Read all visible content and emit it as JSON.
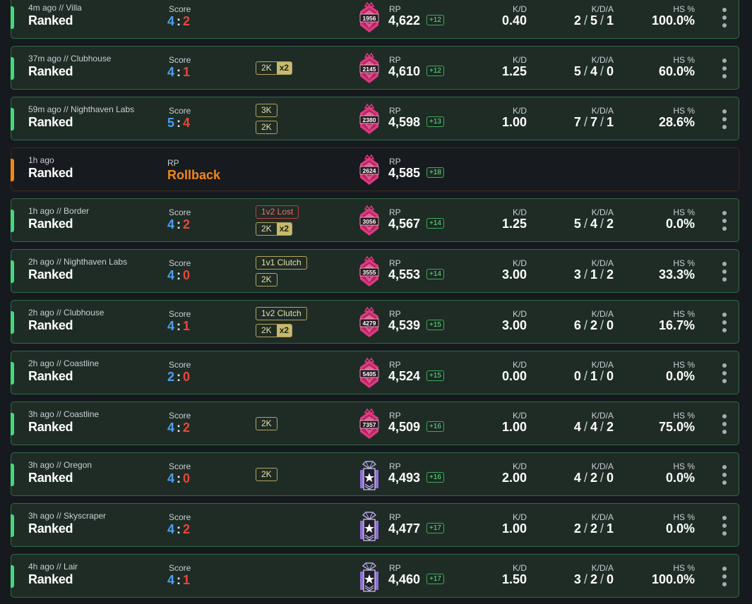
{
  "matches": [
    {
      "meta": "4m ago // Villa",
      "mode": "Ranked",
      "score_label": "Score",
      "score_us": "4",
      "score_sep": ":",
      "score_them": "2",
      "tags": [],
      "rank_tier": "pink",
      "rank_number": "1956",
      "rp_label": "RP",
      "rp": "4,622",
      "rp_delta": "+12",
      "kd_label": "K/D",
      "kd": "0.40",
      "kda_label": "K/D/A",
      "kills": "2",
      "deaths": "5",
      "assists": "1",
      "hs_label": "HS %",
      "hs": "100.0%"
    },
    {
      "meta": "37m ago // Clubhouse",
      "mode": "Ranked",
      "score_label": "Score",
      "score_us": "4",
      "score_sep": ":",
      "score_them": "1",
      "tags": [
        {
          "text": "2K",
          "mult": "x2",
          "type": "normal"
        }
      ],
      "rank_tier": "pink",
      "rank_number": "2145",
      "rp_label": "RP",
      "rp": "4,610",
      "rp_delta": "+12",
      "kd_label": "K/D",
      "kd": "1.25",
      "kda_label": "K/D/A",
      "kills": "5",
      "deaths": "4",
      "assists": "0",
      "hs_label": "HS %",
      "hs": "60.0%"
    },
    {
      "meta": "59m ago // Nighthaven Labs",
      "mode": "Ranked",
      "score_label": "Score",
      "score_us": "5",
      "score_sep": ":",
      "score_them": "4",
      "tags": [
        {
          "text": "3K",
          "mult": "",
          "type": "normal"
        },
        {
          "text": "2K",
          "mult": "",
          "type": "normal"
        }
      ],
      "rank_tier": "pink",
      "rank_number": "2380",
      "rp_label": "RP",
      "rp": "4,598",
      "rp_delta": "+13",
      "kd_label": "K/D",
      "kd": "1.00",
      "kda_label": "K/D/A",
      "kills": "7",
      "deaths": "7",
      "assists": "1",
      "hs_label": "HS %",
      "hs": "28.6%"
    },
    {
      "meta": "1h ago",
      "mode": "Ranked",
      "rollback": true,
      "rollback_label": "RP",
      "rollback_text": "Rollback",
      "tags": [],
      "rank_tier": "pink",
      "rank_number": "2624",
      "rp_label": "RP",
      "rp": "4,585",
      "rp_delta": "+18"
    },
    {
      "meta": "1h ago // Border",
      "mode": "Ranked",
      "score_label": "Score",
      "score_us": "4",
      "score_sep": ":",
      "score_them": "2",
      "tags": [
        {
          "text": "1v2 Lost",
          "mult": "",
          "type": "lost"
        },
        {
          "text": "2K",
          "mult": "x2",
          "type": "normal"
        }
      ],
      "rank_tier": "pink",
      "rank_number": "3056",
      "rp_label": "RP",
      "rp": "4,567",
      "rp_delta": "+14",
      "kd_label": "K/D",
      "kd": "1.25",
      "kda_label": "K/D/A",
      "kills": "5",
      "deaths": "4",
      "assists": "2",
      "hs_label": "HS %",
      "hs": "0.0%"
    },
    {
      "meta": "2h ago // Nighthaven Labs",
      "mode": "Ranked",
      "score_label": "Score",
      "score_us": "4",
      "score_sep": ":",
      "score_them": "0",
      "tags": [
        {
          "text": "1v1 Clutch",
          "mult": "",
          "type": "normal"
        },
        {
          "text": "2K",
          "mult": "",
          "type": "normal"
        }
      ],
      "rank_tier": "pink",
      "rank_number": "3555",
      "rp_label": "RP",
      "rp": "4,553",
      "rp_delta": "+14",
      "kd_label": "K/D",
      "kd": "3.00",
      "kda_label": "K/D/A",
      "kills": "3",
      "deaths": "1",
      "assists": "2",
      "hs_label": "HS %",
      "hs": "33.3%"
    },
    {
      "meta": "2h ago // Clubhouse",
      "mode": "Ranked",
      "score_label": "Score",
      "score_us": "4",
      "score_sep": ":",
      "score_them": "1",
      "tags": [
        {
          "text": "1v2 Clutch",
          "mult": "",
          "type": "normal"
        },
        {
          "text": "2K",
          "mult": "x2",
          "type": "normal"
        }
      ],
      "rank_tier": "pink",
      "rank_number": "4279",
      "rp_label": "RP",
      "rp": "4,539",
      "rp_delta": "+15",
      "kd_label": "K/D",
      "kd": "3.00",
      "kda_label": "K/D/A",
      "kills": "6",
      "deaths": "2",
      "assists": "0",
      "hs_label": "HS %",
      "hs": "16.7%"
    },
    {
      "meta": "2h ago // Coastline",
      "mode": "Ranked",
      "score_label": "Score",
      "score_us": "2",
      "score_sep": ":",
      "score_them": "0",
      "tags": [],
      "rank_tier": "pink",
      "rank_number": "5405",
      "rp_label": "RP",
      "rp": "4,524",
      "rp_delta": "+15",
      "kd_label": "K/D",
      "kd": "0.00",
      "kda_label": "K/D/A",
      "kills": "0",
      "deaths": "1",
      "assists": "0",
      "hs_label": "HS %",
      "hs": "0.0%"
    },
    {
      "meta": "3h ago // Coastline",
      "mode": "Ranked",
      "score_label": "Score",
      "score_us": "4",
      "score_sep": ":",
      "score_them": "2",
      "tags": [
        {
          "text": "2K",
          "mult": "",
          "type": "normal"
        }
      ],
      "rank_tier": "pink",
      "rank_number": "7357",
      "rp_label": "RP",
      "rp": "4,509",
      "rp_delta": "+16",
      "kd_label": "K/D",
      "kd": "1.00",
      "kda_label": "K/D/A",
      "kills": "4",
      "deaths": "4",
      "assists": "2",
      "hs_label": "HS %",
      "hs": "75.0%"
    },
    {
      "meta": "3h ago // Oregon",
      "mode": "Ranked",
      "score_label": "Score",
      "score_us": "4",
      "score_sep": ":",
      "score_them": "0",
      "tags": [
        {
          "text": "2K",
          "mult": "",
          "type": "normal"
        }
      ],
      "rank_tier": "purple",
      "rank_number": "",
      "rp_label": "RP",
      "rp": "4,493",
      "rp_delta": "+16",
      "kd_label": "K/D",
      "kd": "2.00",
      "kda_label": "K/D/A",
      "kills": "4",
      "deaths": "2",
      "assists": "0",
      "hs_label": "HS %",
      "hs": "0.0%"
    },
    {
      "meta": "3h ago // Skyscraper",
      "mode": "Ranked",
      "score_label": "Score",
      "score_us": "4",
      "score_sep": ":",
      "score_them": "2",
      "tags": [],
      "rank_tier": "purple",
      "rank_number": "",
      "rp_label": "RP",
      "rp": "4,477",
      "rp_delta": "+17",
      "kd_label": "K/D",
      "kd": "1.00",
      "kda_label": "K/D/A",
      "kills": "2",
      "deaths": "2",
      "assists": "1",
      "hs_label": "HS %",
      "hs": "0.0%"
    },
    {
      "meta": "4h ago // Lair",
      "mode": "Ranked",
      "score_label": "Score",
      "score_us": "4",
      "score_sep": ":",
      "score_them": "1",
      "tags": [],
      "rank_tier": "purple",
      "rank_number": "",
      "rp_label": "RP",
      "rp": "4,460",
      "rp_delta": "+17",
      "kd_label": "K/D",
      "kd": "1.50",
      "kda_label": "K/D/A",
      "kills": "3",
      "deaths": "2",
      "assists": "0",
      "hs_label": "HS %",
      "hs": "100.0%"
    }
  ],
  "colors": {
    "card_bg": "#1f2c26",
    "card_border": "#2f6a46",
    "accent_win": "#44d97a",
    "accent_rollback": "#f08a14",
    "score_us": "#4ca0f0",
    "score_them": "#e8463c",
    "rollback": "#f0871a",
    "rank_pink": "#e0397f",
    "rank_purple": "#8e6fd1",
    "delta_green": "#6ce08e"
  },
  "icons": {
    "menu": "more-vertical-icon",
    "rank_pink": "champion-rank-icon",
    "rank_purple": "diamond-rank-icon"
  }
}
